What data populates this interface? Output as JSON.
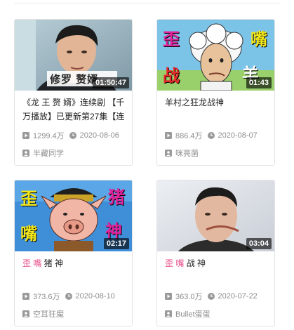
{
  "cards": [
    {
      "title": "《龙 王 赘 婿》连续剧 【千万播放】已更新第27集【连",
      "title_prefix": "",
      "duration": "01:50:47",
      "views": "1299.4万",
      "date": "2020-08-06",
      "author": "半藏同学",
      "thumb_text": "修罗 赘婿"
    },
    {
      "title": "羊村之狂龙战神",
      "title_prefix": "",
      "duration": "01:43",
      "views": "886.4万",
      "date": "2020-08-07",
      "author": "咪亮菌",
      "thumb_chars": [
        "歪",
        "嘴",
        "战",
        "羊"
      ]
    },
    {
      "title": "猪 神",
      "title_prefix": "歪 嘴",
      "duration": "02:17",
      "views": "373.6万",
      "date": "2020-08-10",
      "author": "空耳狂魔",
      "thumb_chars": [
        "歪",
        "猪",
        "嘴",
        "神"
      ]
    },
    {
      "title": "战 神",
      "title_prefix": "歪 嘴",
      "duration": "03:04",
      "views": "363.0万",
      "date": "2020-07-22",
      "author": "Bullet蛋蛋"
    }
  ],
  "colors": {
    "highlight": "#e8508c",
    "meta": "#8e8e8e"
  }
}
